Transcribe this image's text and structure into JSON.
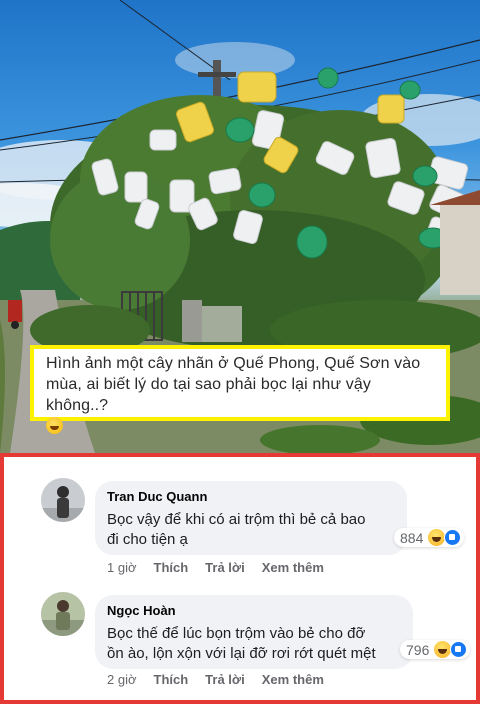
{
  "photo": {
    "caption": "Hình ảnh một cây nhãn ở Quế Phong, Quế Sơn vào mùa, ai biết lý do tại sao phải bọc lại như vậy không..?",
    "caption_emoji": "grinning-face-emoji"
  },
  "comments": [
    {
      "author": "Tran Duc Quann",
      "text_line1": "Bọc vậy để khi có ai trộm thì bẻ cả bao",
      "text_line2": "đi cho tiện ạ",
      "reaction_count": "884",
      "time": "1 giờ",
      "like": "Thích",
      "reply": "Trả lời",
      "translate": "Xem thêm"
    },
    {
      "author": "Ngọc Hoàn",
      "text_line1": "Bọc thế để lúc bọn trộm vào bẻ cho đỡ",
      "text_line2": "ồn ào, lộn xộn với lại đỡ rơi rớt quét mệt",
      "reaction_count": "796",
      "time": "2 giờ",
      "like": "Thích",
      "reply": "Trả lời",
      "translate": "Xem thêm"
    }
  ],
  "colors": {
    "caption_border": "#fff200",
    "comments_border": "#e53935",
    "bubble_bg": "#f0f2f5",
    "like_blue": "#1877f2"
  }
}
